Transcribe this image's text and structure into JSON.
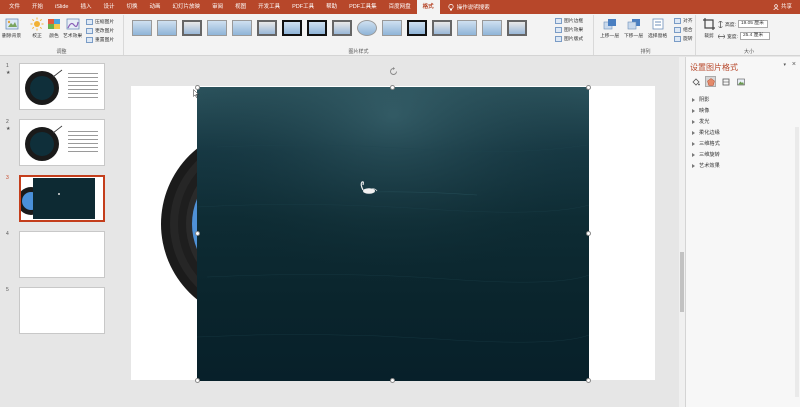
{
  "menu": {
    "tabs": [
      "文件",
      "开始",
      "iSlide",
      "插入",
      "设计",
      "切换",
      "动画",
      "幻灯片放映",
      "审阅",
      "视图",
      "开发工具",
      "PDF工具",
      "帮助",
      "PDF工具集",
      "百度网盘",
      "格式"
    ],
    "active_index": 15,
    "tell_me": "操作说明搜索",
    "share": "共享"
  },
  "ribbon": {
    "adjust": {
      "remove_bg": "删除背景",
      "corrections": "校正",
      "color": "颜色",
      "artistic": "艺术效果",
      "compress": "压缩图片",
      "change": "更改图片",
      "reset": "重置图片",
      "group_label": "调整"
    },
    "styles": {
      "border": "图片边框",
      "effects": "图片效果",
      "layout": "图片版式",
      "group_label": "图片样式"
    },
    "arrange": {
      "bring_forward": "上移一层",
      "send_backward": "下移一层",
      "selection_pane": "选择窗格",
      "align": "对齐",
      "group": "组合",
      "rotate": "旋转",
      "group_label": "排列"
    },
    "size": {
      "crop": "裁剪",
      "height_label": "高度:",
      "height_value": "19.05 厘米",
      "width_label": "宽度:",
      "width_value": "25.4 厘米",
      "group_label": "大小"
    }
  },
  "slides": {
    "numbers": [
      "1",
      "2",
      "3",
      "4",
      "5"
    ],
    "selected_index": 2
  },
  "format_pane": {
    "title": "设置图片格式",
    "sections": [
      "阴影",
      "映像",
      "发光",
      "柔化边缘",
      "三维格式",
      "三维旋转",
      "艺术效果"
    ]
  },
  "colors": {
    "accent": "#b7472a",
    "photo_dark": "#0a242c"
  }
}
